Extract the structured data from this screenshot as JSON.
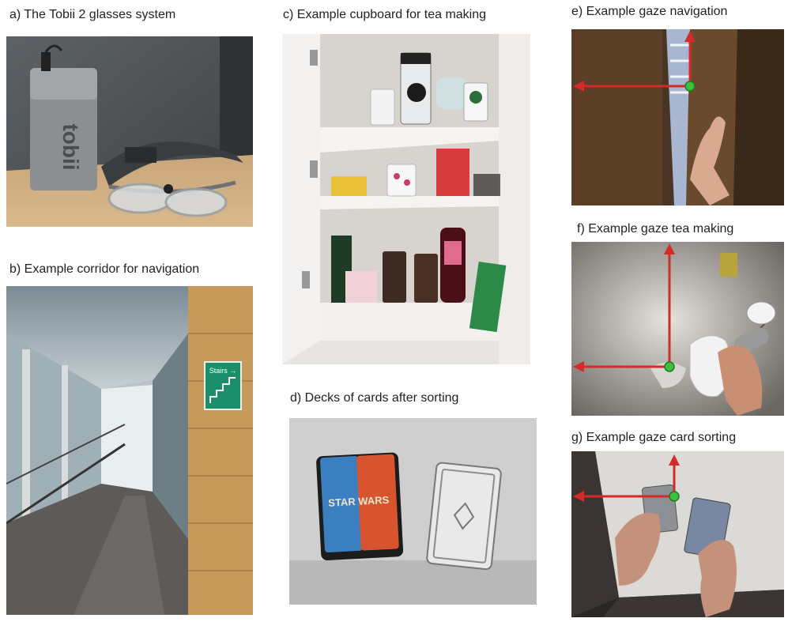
{
  "panels": {
    "a": {
      "caption": "a) The Tobii 2 glasses system",
      "device_label": "tobii"
    },
    "b": {
      "caption": "b) Example corridor for navigation",
      "sign_text": "Stairs →"
    },
    "c": {
      "caption": "c) Example cupboard for tea making"
    },
    "d": {
      "caption": "d) Decks of cards after sorting",
      "deck_text": "STAR WARS"
    },
    "e": {
      "caption": "e) Example gaze navigation"
    },
    "f": {
      "caption": "f) Example gaze tea making"
    },
    "g": {
      "caption": "g) Example gaze card sorting"
    }
  },
  "gaze_point_color": "#3fbf3f",
  "gaze_arrow_color": "#d42a2a"
}
